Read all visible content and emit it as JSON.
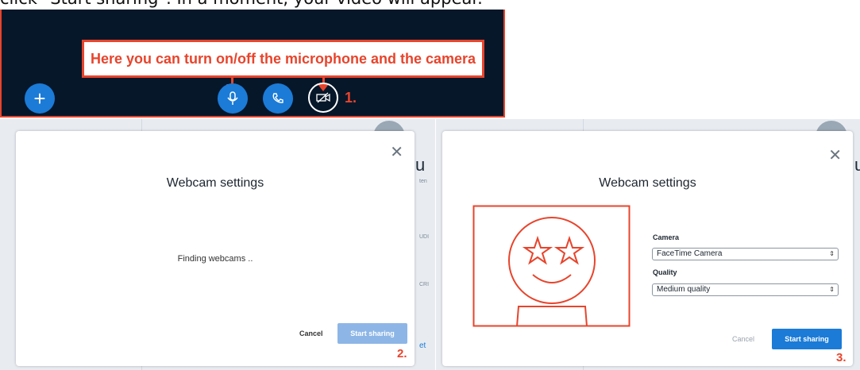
{
  "caption": "click \"Start sharing\". In a moment, your video will appear.",
  "callout": {
    "text": "Here  you can turn on/off the microphone and the camera"
  },
  "toolbar": {
    "step_label": "1."
  },
  "modal_left": {
    "title": "Webcam settings",
    "status": "Finding webcams ..",
    "cancel_label": "Cancel",
    "start_label": "Start sharing",
    "step_label": "2."
  },
  "modal_right": {
    "title": "Webcam settings",
    "camera_label": "Camera",
    "camera_value": "FaceTime Camera",
    "quality_label": "Quality",
    "quality_value": "Medium quality",
    "cancel_label": "Cancel",
    "start_label": "Start sharing",
    "step_label": "3."
  },
  "colors": {
    "accent": "#1b7bd7",
    "annotation": "#e8442c",
    "toolbar_bg": "#06172a",
    "start_disabled": "#8db6e6"
  }
}
